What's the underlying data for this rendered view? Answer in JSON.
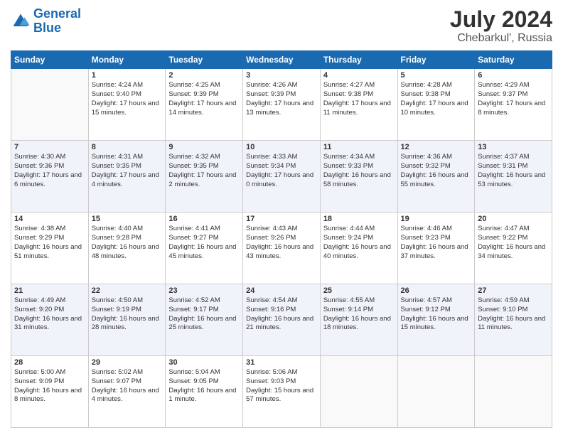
{
  "logo": {
    "line1": "General",
    "line2": "Blue"
  },
  "title": "July 2024",
  "subtitle": "Chebarkul', Russia",
  "days_of_week": [
    "Sunday",
    "Monday",
    "Tuesday",
    "Wednesday",
    "Thursday",
    "Friday",
    "Saturday"
  ],
  "weeks": [
    [
      {
        "day": "",
        "sunrise": "",
        "sunset": "",
        "daylight": "",
        "empty": true
      },
      {
        "day": "1",
        "sunrise": "Sunrise: 4:24 AM",
        "sunset": "Sunset: 9:40 PM",
        "daylight": "Daylight: 17 hours and 15 minutes.",
        "empty": false
      },
      {
        "day": "2",
        "sunrise": "Sunrise: 4:25 AM",
        "sunset": "Sunset: 9:39 PM",
        "daylight": "Daylight: 17 hours and 14 minutes.",
        "empty": false
      },
      {
        "day": "3",
        "sunrise": "Sunrise: 4:26 AM",
        "sunset": "Sunset: 9:39 PM",
        "daylight": "Daylight: 17 hours and 13 minutes.",
        "empty": false
      },
      {
        "day": "4",
        "sunrise": "Sunrise: 4:27 AM",
        "sunset": "Sunset: 9:38 PM",
        "daylight": "Daylight: 17 hours and 11 minutes.",
        "empty": false
      },
      {
        "day": "5",
        "sunrise": "Sunrise: 4:28 AM",
        "sunset": "Sunset: 9:38 PM",
        "daylight": "Daylight: 17 hours and 10 minutes.",
        "empty": false
      },
      {
        "day": "6",
        "sunrise": "Sunrise: 4:29 AM",
        "sunset": "Sunset: 9:37 PM",
        "daylight": "Daylight: 17 hours and 8 minutes.",
        "empty": false
      }
    ],
    [
      {
        "day": "7",
        "sunrise": "Sunrise: 4:30 AM",
        "sunset": "Sunset: 9:36 PM",
        "daylight": "Daylight: 17 hours and 6 minutes.",
        "empty": false
      },
      {
        "day": "8",
        "sunrise": "Sunrise: 4:31 AM",
        "sunset": "Sunset: 9:35 PM",
        "daylight": "Daylight: 17 hours and 4 minutes.",
        "empty": false
      },
      {
        "day": "9",
        "sunrise": "Sunrise: 4:32 AM",
        "sunset": "Sunset: 9:35 PM",
        "daylight": "Daylight: 17 hours and 2 minutes.",
        "empty": false
      },
      {
        "day": "10",
        "sunrise": "Sunrise: 4:33 AM",
        "sunset": "Sunset: 9:34 PM",
        "daylight": "Daylight: 17 hours and 0 minutes.",
        "empty": false
      },
      {
        "day": "11",
        "sunrise": "Sunrise: 4:34 AM",
        "sunset": "Sunset: 9:33 PM",
        "daylight": "Daylight: 16 hours and 58 minutes.",
        "empty": false
      },
      {
        "day": "12",
        "sunrise": "Sunrise: 4:36 AM",
        "sunset": "Sunset: 9:32 PM",
        "daylight": "Daylight: 16 hours and 55 minutes.",
        "empty": false
      },
      {
        "day": "13",
        "sunrise": "Sunrise: 4:37 AM",
        "sunset": "Sunset: 9:31 PM",
        "daylight": "Daylight: 16 hours and 53 minutes.",
        "empty": false
      }
    ],
    [
      {
        "day": "14",
        "sunrise": "Sunrise: 4:38 AM",
        "sunset": "Sunset: 9:29 PM",
        "daylight": "Daylight: 16 hours and 51 minutes.",
        "empty": false
      },
      {
        "day": "15",
        "sunrise": "Sunrise: 4:40 AM",
        "sunset": "Sunset: 9:28 PM",
        "daylight": "Daylight: 16 hours and 48 minutes.",
        "empty": false
      },
      {
        "day": "16",
        "sunrise": "Sunrise: 4:41 AM",
        "sunset": "Sunset: 9:27 PM",
        "daylight": "Daylight: 16 hours and 45 minutes.",
        "empty": false
      },
      {
        "day": "17",
        "sunrise": "Sunrise: 4:43 AM",
        "sunset": "Sunset: 9:26 PM",
        "daylight": "Daylight: 16 hours and 43 minutes.",
        "empty": false
      },
      {
        "day": "18",
        "sunrise": "Sunrise: 4:44 AM",
        "sunset": "Sunset: 9:24 PM",
        "daylight": "Daylight: 16 hours and 40 minutes.",
        "empty": false
      },
      {
        "day": "19",
        "sunrise": "Sunrise: 4:46 AM",
        "sunset": "Sunset: 9:23 PM",
        "daylight": "Daylight: 16 hours and 37 minutes.",
        "empty": false
      },
      {
        "day": "20",
        "sunrise": "Sunrise: 4:47 AM",
        "sunset": "Sunset: 9:22 PM",
        "daylight": "Daylight: 16 hours and 34 minutes.",
        "empty": false
      }
    ],
    [
      {
        "day": "21",
        "sunrise": "Sunrise: 4:49 AM",
        "sunset": "Sunset: 9:20 PM",
        "daylight": "Daylight: 16 hours and 31 minutes.",
        "empty": false
      },
      {
        "day": "22",
        "sunrise": "Sunrise: 4:50 AM",
        "sunset": "Sunset: 9:19 PM",
        "daylight": "Daylight: 16 hours and 28 minutes.",
        "empty": false
      },
      {
        "day": "23",
        "sunrise": "Sunrise: 4:52 AM",
        "sunset": "Sunset: 9:17 PM",
        "daylight": "Daylight: 16 hours and 25 minutes.",
        "empty": false
      },
      {
        "day": "24",
        "sunrise": "Sunrise: 4:54 AM",
        "sunset": "Sunset: 9:16 PM",
        "daylight": "Daylight: 16 hours and 21 minutes.",
        "empty": false
      },
      {
        "day": "25",
        "sunrise": "Sunrise: 4:55 AM",
        "sunset": "Sunset: 9:14 PM",
        "daylight": "Daylight: 16 hours and 18 minutes.",
        "empty": false
      },
      {
        "day": "26",
        "sunrise": "Sunrise: 4:57 AM",
        "sunset": "Sunset: 9:12 PM",
        "daylight": "Daylight: 16 hours and 15 minutes.",
        "empty": false
      },
      {
        "day": "27",
        "sunrise": "Sunrise: 4:59 AM",
        "sunset": "Sunset: 9:10 PM",
        "daylight": "Daylight: 16 hours and 11 minutes.",
        "empty": false
      }
    ],
    [
      {
        "day": "28",
        "sunrise": "Sunrise: 5:00 AM",
        "sunset": "Sunset: 9:09 PM",
        "daylight": "Daylight: 16 hours and 8 minutes.",
        "empty": false
      },
      {
        "day": "29",
        "sunrise": "Sunrise: 5:02 AM",
        "sunset": "Sunset: 9:07 PM",
        "daylight": "Daylight: 16 hours and 4 minutes.",
        "empty": false
      },
      {
        "day": "30",
        "sunrise": "Sunrise: 5:04 AM",
        "sunset": "Sunset: 9:05 PM",
        "daylight": "Daylight: 16 hours and 1 minute.",
        "empty": false
      },
      {
        "day": "31",
        "sunrise": "Sunrise: 5:06 AM",
        "sunset": "Sunset: 9:03 PM",
        "daylight": "Daylight: 15 hours and 57 minutes.",
        "empty": false
      },
      {
        "day": "",
        "sunrise": "",
        "sunset": "",
        "daylight": "",
        "empty": true
      },
      {
        "day": "",
        "sunrise": "",
        "sunset": "",
        "daylight": "",
        "empty": true
      },
      {
        "day": "",
        "sunrise": "",
        "sunset": "",
        "daylight": "",
        "empty": true
      }
    ]
  ]
}
